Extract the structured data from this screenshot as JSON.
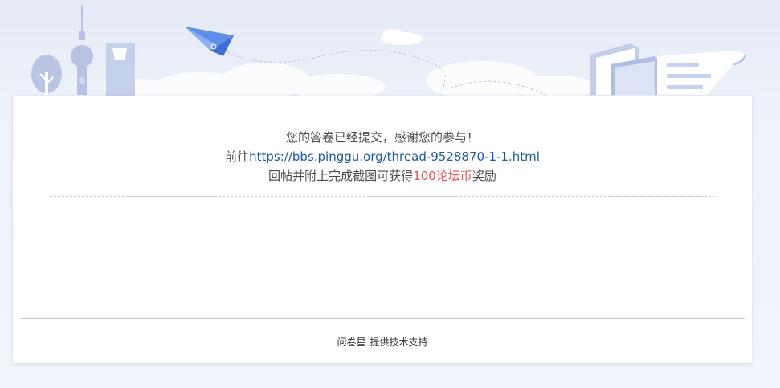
{
  "message": {
    "line1": "您的答卷已经提交，感谢您的参与！",
    "line2_prefix": "前往",
    "link": "https://bbs.pinggu.org/thread-9528870-1-1.html",
    "line3_prefix": "回帖并附上完成截图可获得",
    "reward": "100论坛币",
    "line3_suffix": "奖励"
  },
  "footer": {
    "brand": "问卷星",
    "support": "提供技术支持"
  },
  "colors": {
    "link": "#1e5aa3",
    "reward": "#ef4d4d"
  }
}
